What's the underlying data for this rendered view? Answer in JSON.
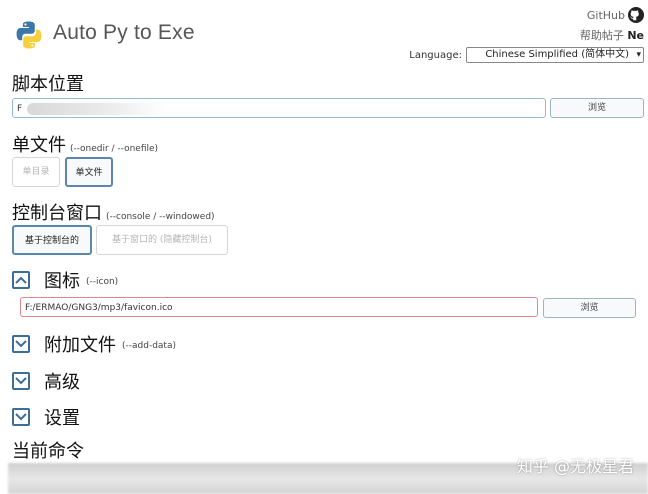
{
  "app": {
    "title": "Auto Py to Exe"
  },
  "header": {
    "github_label": "GitHub",
    "help_label": "帮助帖子",
    "help_suffix": "Ne",
    "language_label": "Language:",
    "language_value": "Chinese Simplified (简体中文)"
  },
  "script_location": {
    "title": "脚本位置",
    "value": "F",
    "browse_label": "浏览"
  },
  "onefile": {
    "title": "单文件",
    "subtitle": "(--onedir / --onefile)",
    "options": [
      "单目录",
      "单文件"
    ],
    "selected": "单文件"
  },
  "console": {
    "title": "控制台窗口",
    "subtitle": "(--console / --windowed)",
    "options": [
      "基于控制台的",
      "基于窗口的 (隐藏控制台)"
    ],
    "selected": "基于控制台的"
  },
  "icon_section": {
    "title": "图标",
    "subtitle": "(--icon)",
    "expanded": true,
    "value": "F:/ERMAO/GNG3/mp3/favicon.ico",
    "browse_label": "浏览"
  },
  "additional_files": {
    "title": "附加文件",
    "subtitle": "(--add-data)",
    "expanded": false
  },
  "advanced": {
    "title": "高级",
    "expanded": false
  },
  "settings": {
    "title": "设置",
    "expanded": false
  },
  "current_command": {
    "title": "当前命令"
  },
  "watermark": "知乎 @无极星君",
  "colors": {
    "accent": "#3c6e98",
    "input_border": "#99b8d6",
    "error_border": "#e08888"
  }
}
